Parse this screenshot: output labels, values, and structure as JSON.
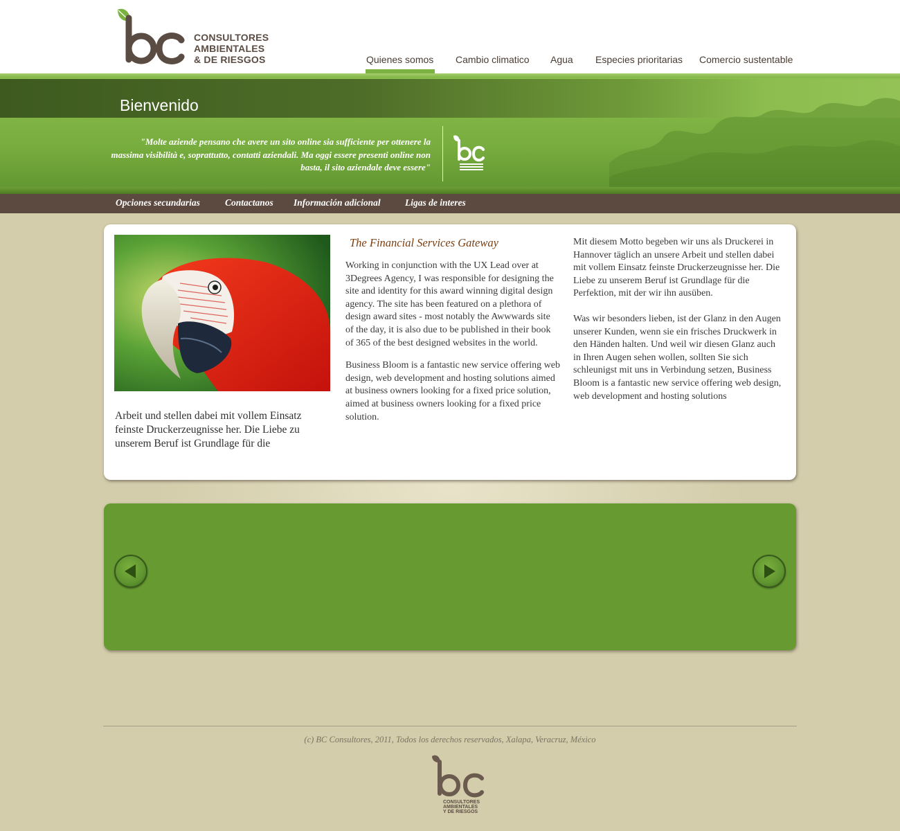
{
  "header": {
    "logo_lines": [
      "CONSULTORES",
      "AMBIENTALES",
      "& DE RIESGOS"
    ],
    "logo_mark_text": "bc",
    "nav": [
      {
        "label": "Quienes somos",
        "active": true
      },
      {
        "label": "Cambio climatico",
        "active": false
      },
      {
        "label": "Agua",
        "active": false
      },
      {
        "label": "Especies prioritarias",
        "active": false
      },
      {
        "label": "Comercio sustentable",
        "active": false
      }
    ]
  },
  "banner": {
    "title": "Bienvenido",
    "quote": "\"Molte aziende pensano che avere un sito online sia sufficiente per ottenere la massima visibilità e, soprattutto, contatti aziendali. Ma oggi essere presenti online non basta, il sito aziendale deve essere\""
  },
  "subnav": [
    "Opciones secundarias",
    "Contactanos",
    "Información adicional",
    "Ligas de interes"
  ],
  "content": {
    "left_text": "Arbeit und stellen dabei mit vollem Einsatz feinste Druckerzeugnisse her. Die Liebe zu unserem Beruf ist Grundlage für die",
    "mid_heading": "The Financial Services Gateway",
    "mid_paragraphs": [
      "Working in conjunction with the UX Lead over at 3Degrees Agency, I was responsible for designing the site and identity for this award winning digital design agency. The site has been featured on a plethora of design award sites - most notably the Awwwards site of the day, it is also due to be published in their book of 365 of the best designed websites in the world.",
      "Business Bloom is a fantastic new service offering web design, web development and hosting solutions aimed at business owners looking for a fixed price solution, aimed at business owners looking for a fixed price solution."
    ],
    "right_paragraphs": [
      "Mit diesem Motto begeben wir uns als Druckerei in Hannover täglich an unsere Arbeit und stellen dabei mit vollem Einsatz feinste Druckerzeugnisse her. Die Liebe zu unserem Beruf ist Grundlage für die Perfektion, mit der wir ihn ausüben.",
      "Was wir besonders lieben, ist der Glanz in den Augen unserer Kunden, wenn sie ein frisches Druckwerk in den Händen halten. Und weil wir diesen Glanz auch in Ihren Augen sehen wollen, sollten Sie sich schleunigst mit uns in Verbindung setzen, Business Bloom is a fantastic new service offering web design, web development and hosting solutions"
    ]
  },
  "footer": {
    "copyright": "(c) BC Consultores, 2011, Todos los derechos reservados, Xalapa, Veracruz, México",
    "logo_lines": [
      "CONSULTORES",
      "AMBIENTALES",
      "Y DE RIESGOS"
    ]
  },
  "colors": {
    "brand_brown": "#5b4c43",
    "brand_green": "#7bb241",
    "slider_green": "#679b31",
    "page_bg": "#d3cdab",
    "subnav_bg": "#5c4a40"
  },
  "icons": [
    "leaf-icon",
    "arrow-left-icon",
    "arrow-right-icon"
  ]
}
